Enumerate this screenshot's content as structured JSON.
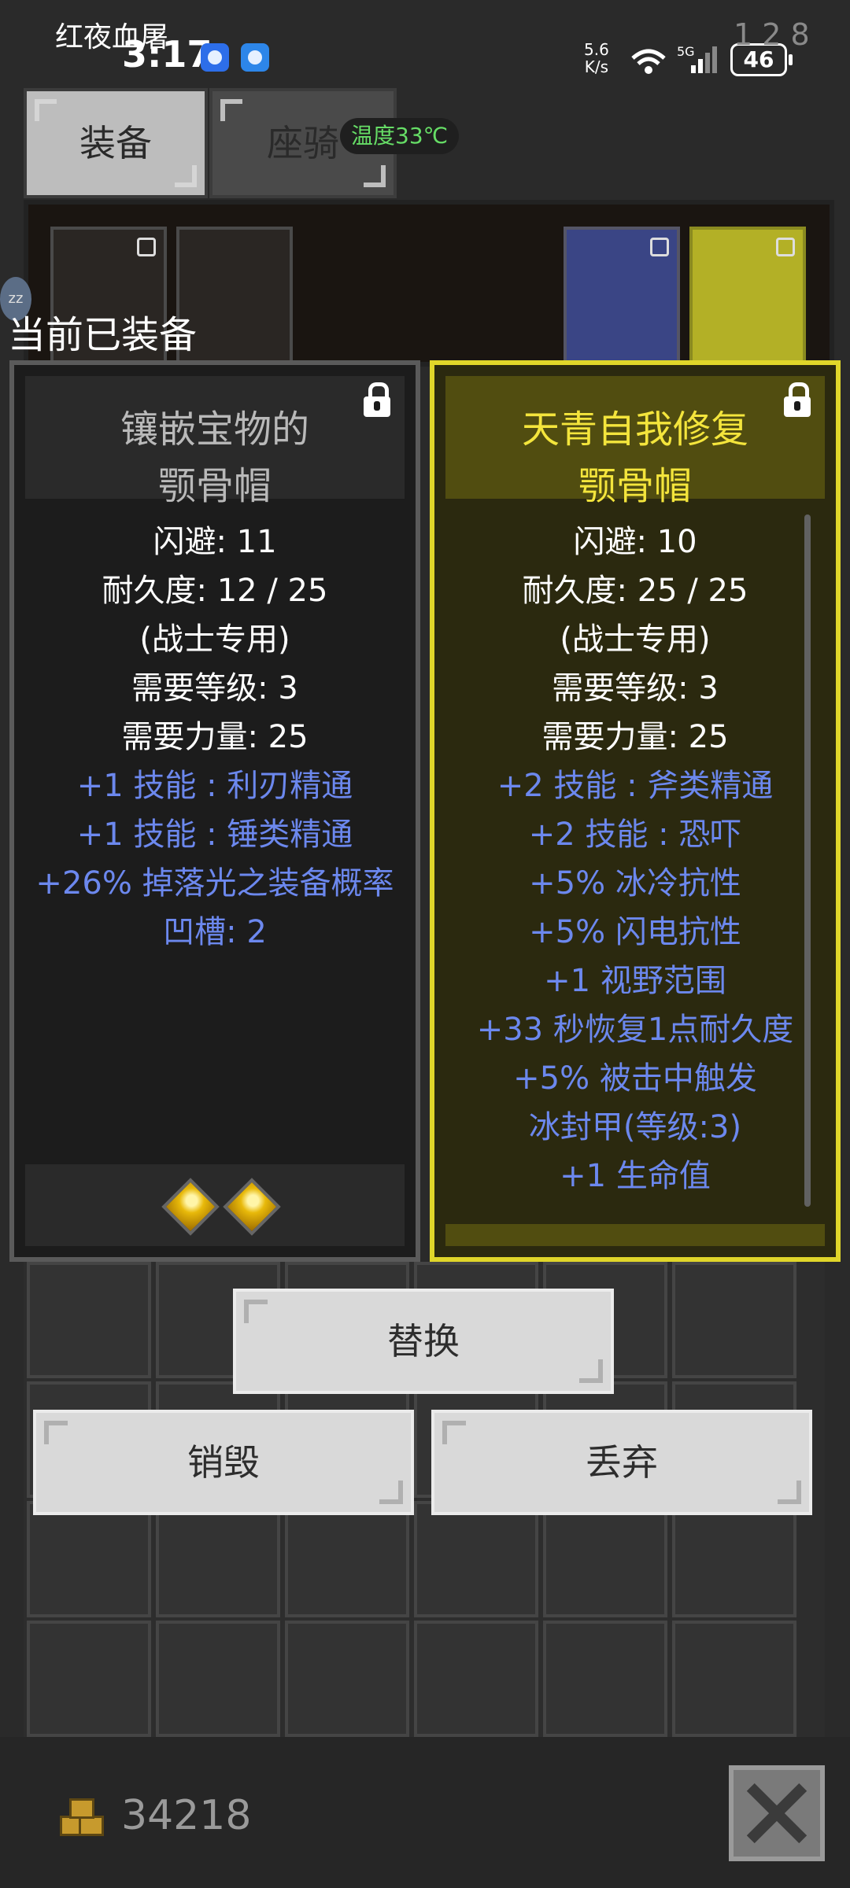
{
  "status_bar": {
    "app_name": "红夜血屠",
    "time": "3:17",
    "net_speed_value": "5.6",
    "net_speed_unit": "K/s",
    "network": "5G",
    "battery": "46",
    "corner_number": "1 2 8"
  },
  "tabs": [
    {
      "label": "装备"
    },
    {
      "label": "座骑"
    }
  ],
  "temperature": "温度33℃",
  "equipped_label": "当前已装备",
  "left_card": {
    "title_line1": "镶嵌宝物的",
    "title_line2": "颚骨帽",
    "stats": [
      {
        "text": "闪避: 11",
        "color": "white"
      },
      {
        "text": "耐久度: 12 / 25",
        "color": "white"
      },
      {
        "text": "(战士专用)",
        "color": "white"
      },
      {
        "text": "需要等级: 3",
        "color": "white"
      },
      {
        "text": "需要力量: 25",
        "color": "white"
      },
      {
        "text": "+1 技能 : 利刃精通",
        "color": "blue"
      },
      {
        "text": "+1 技能 : 锤类精通",
        "color": "blue"
      },
      {
        "text": "+26% 掉落光之装备概率",
        "color": "blue"
      },
      {
        "text": "凹槽: 2",
        "color": "blue"
      }
    ],
    "gems": 2
  },
  "right_card": {
    "title_line1": "天青自我修复",
    "title_line2": "颚骨帽",
    "stats": [
      {
        "text": "闪避: 10",
        "color": "white"
      },
      {
        "text": "耐久度: 25 / 25",
        "color": "white"
      },
      {
        "text": "(战士专用)",
        "color": "white"
      },
      {
        "text": "需要等级: 3",
        "color": "white"
      },
      {
        "text": "需要力量: 25",
        "color": "white"
      },
      {
        "text": "+2 技能 : 斧类精通",
        "color": "blue"
      },
      {
        "text": "+2 技能 : 恐吓",
        "color": "blue"
      },
      {
        "text": "+5% 冰冷抗性",
        "color": "blue"
      },
      {
        "text": "+5% 闪电抗性",
        "color": "blue"
      },
      {
        "text": "+1 视野范围",
        "color": "blue"
      },
      {
        "text": "+33 秒恢复1点耐久度",
        "color": "blue"
      },
      {
        "text": "+5% 被击中触发",
        "color": "blue"
      },
      {
        "text": "冰封甲(等级:3)",
        "color": "blue"
      },
      {
        "text": "+1 生命值",
        "color": "blue"
      }
    ]
  },
  "buttons": {
    "replace": "替换",
    "destroy": "销毁",
    "discard": "丢弃"
  },
  "gold": "34218",
  "colors": {
    "blue_stat": "#6c88ee",
    "yellow_title": "#f4e53c",
    "gray_title": "#b9b9b9"
  }
}
